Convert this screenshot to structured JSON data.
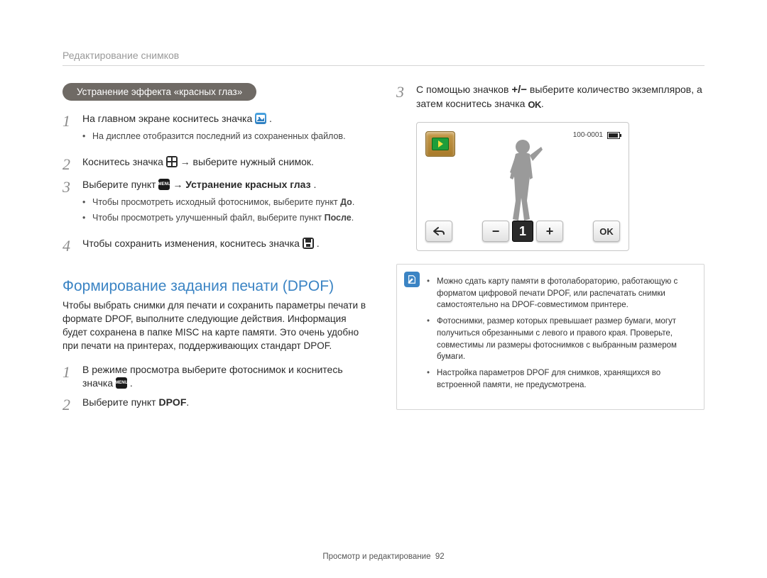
{
  "breadcrumb": "Редактирование снимков",
  "left": {
    "pill": "Устранение эффекта «красных глаз»",
    "step1": {
      "num": "1",
      "text_a": "На главном экране коснитесь значка ",
      "text_b": ".",
      "bullet1": "На дисплее отобразится последний из сохраненных файлов."
    },
    "step2": {
      "num": "2",
      "text_a": "Коснитесь значка ",
      "text_b": " → выберите нужный снимок."
    },
    "step3": {
      "num": "3",
      "text_a": "Выберите пункт ",
      "text_b": " → ",
      "bold": "Устранение красных глаз",
      "text_c": ".",
      "bullet1_a": "Чтобы просмотреть исходный фотоснимок, выберите пункт ",
      "bullet1_bold": "До",
      "bullet1_b": ".",
      "bullet2_a": "Чтобы просмотреть улучшенный файл, выберите пункт ",
      "bullet2_bold": "После",
      "bullet2_b": "."
    },
    "step4": {
      "num": "4",
      "text_a": "Чтобы сохранить изменения, коснитесь значка ",
      "text_b": "."
    },
    "h2": "Формирование задания печати (DPOF)",
    "para": "Чтобы выбрать снимки для печати и сохранить параметры печати в формате DPOF, выполните следующие действия. Информация будет сохранена в папке MISC на карте памяти. Это очень удобно при печати на принтерах, поддерживающих стандарт DPOF.",
    "d_step1": {
      "num": "1",
      "text_a": "В режиме просмотра выберите фотоснимок и коснитесь значка ",
      "text_b": "."
    },
    "d_step2": {
      "num": "2",
      "text_a": "Выберите пункт ",
      "bold": "DPOF",
      "text_b": "."
    }
  },
  "right": {
    "step3": {
      "num": "3",
      "text_a": "С помощью значков ",
      "pm": "+/−",
      "text_b": " выберите количество экземпляров, а затем коснитесь значка ",
      "ok": "OK",
      "text_c": "."
    },
    "shot": {
      "file_no": "100-0001",
      "count": "1",
      "ok": "OK"
    },
    "note": {
      "b1": "Можно сдать карту памяти в фотолабораторию, работающую с форматом цифровой печати DPOF, или распечатать снимки самостоятельно на DPOF-совместимом принтере.",
      "b2": "Фотоснимки, размер которых превышает размер бумаги, могут получиться обрезанными с левого и правого края. Проверьте, совместимы ли размеры фотоснимков с выбранным размером бумаги.",
      "b3": "Настройка параметров DPOF для снимков, хранящихся во встроенной памяти, не предусмотрена."
    }
  },
  "icons": {
    "menu_label": "MENU"
  },
  "footer": {
    "section": "Просмотр и редактирование",
    "page": "92"
  }
}
